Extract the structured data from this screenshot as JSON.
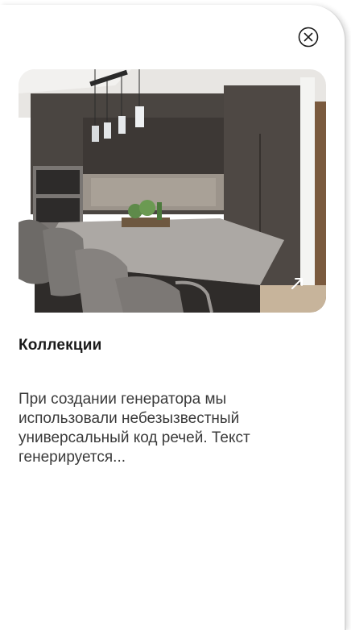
{
  "modal": {
    "title": "Коллекции",
    "description": "При создании генератора мы использовали небезызвестный универсальный код речей. Текст генерируется..."
  },
  "icons": {
    "close": "close-circle-icon",
    "expand": "expand-arrow-icon"
  }
}
